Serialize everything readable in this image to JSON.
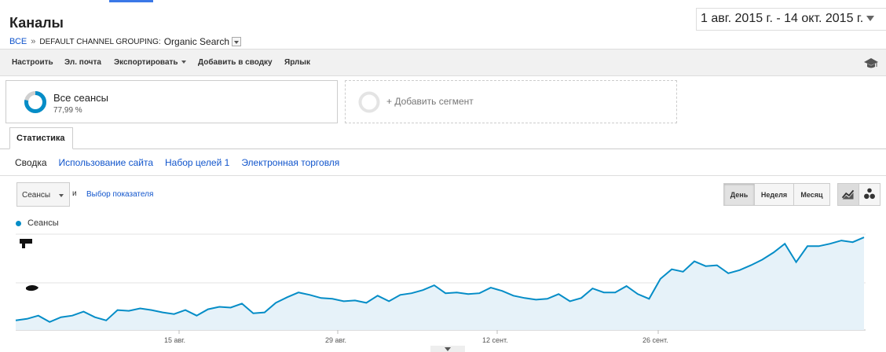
{
  "header": {
    "title": "Каналы",
    "breadcrumb": {
      "root": "ВСЕ",
      "separator": "»",
      "group": "DEFAULT CHANNEL GROUPING:",
      "value": "Organic Search"
    },
    "date_range": "1 авг. 2015 г. - 14 окт. 2015 г."
  },
  "toolbar": {
    "customize": "Настроить",
    "email": "Эл. почта",
    "export": "Экспортировать",
    "add_to_dashboard": "Добавить в сводку",
    "shortcut": "Ярлык",
    "icon": "graduation-cap-icon"
  },
  "segments": {
    "all_sessions": {
      "name": "Все сеансы",
      "percent": "77,99 %",
      "fraction": 0.7799
    },
    "add_segment": "+ Добавить сегмент"
  },
  "tabs": {
    "stats": "Статистика"
  },
  "subtabs": [
    "Сводка",
    "Использование сайта",
    "Набор целей 1",
    "Электронная торговля"
  ],
  "controls": {
    "metric": "Сеансы",
    "and": "и",
    "choose_metric": "Выбор показателя",
    "periods": [
      "День",
      "Неделя",
      "Месяц"
    ],
    "active_period": "День"
  },
  "colors": {
    "series": "#058dc7",
    "fill": "#e6f2f9",
    "link": "#1155cc"
  },
  "chart_data": {
    "type": "area",
    "series": [
      {
        "name": "Сеансы",
        "values": [
          12,
          14,
          18,
          10,
          16,
          18,
          23,
          16,
          12,
          25,
          24,
          27,
          25,
          22,
          20,
          25,
          18,
          26,
          29,
          28,
          33,
          21,
          22,
          34,
          41,
          47,
          44,
          40,
          39,
          36,
          37,
          34,
          43,
          36,
          44,
          46,
          50,
          56,
          46,
          47,
          45,
          46,
          53,
          49,
          43,
          40,
          38,
          39,
          45,
          36,
          40,
          52,
          47,
          47,
          55,
          45,
          39,
          64,
          76,
          73,
          86,
          80,
          81,
          71,
          75,
          81,
          88,
          97,
          108,
          85,
          105,
          105,
          108,
          112,
          110,
          116
        ]
      }
    ],
    "x_tick_labels": [
      "15 авг.",
      "29 авг.",
      "12 сент.",
      "26 сент."
    ],
    "legend": "top-left",
    "grid": true
  },
  "footer_caret_icon": "chevron-down-icon"
}
